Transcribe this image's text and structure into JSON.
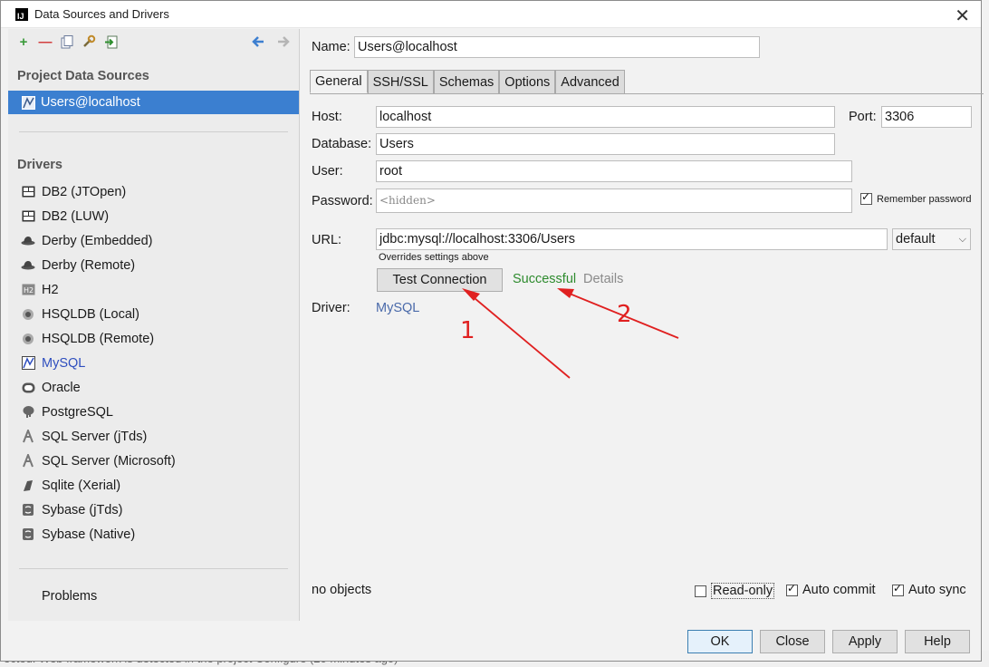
{
  "window": {
    "title": "Data Sources and Drivers",
    "close": "✕"
  },
  "background": {
    "status_text": "ected: Web framework is detected in the project Configure (20 minutes ago)"
  },
  "left": {
    "project_header": "Project Data Sources",
    "selected_source": "Users@localhost",
    "drivers_header": "Drivers",
    "drivers": [
      {
        "label": "DB2 (JTOpen)",
        "icon": "db2-icon"
      },
      {
        "label": "DB2 (LUW)",
        "icon": "db2-icon"
      },
      {
        "label": "Derby (Embedded)",
        "icon": "derby-icon"
      },
      {
        "label": "Derby (Remote)",
        "icon": "derby-icon"
      },
      {
        "label": "H2",
        "icon": "h2-icon"
      },
      {
        "label": "HSQLDB (Local)",
        "icon": "hsqldb-icon"
      },
      {
        "label": "HSQLDB (Remote)",
        "icon": "hsqldb-icon"
      },
      {
        "label": "MySQL",
        "icon": "mysql-icon"
      },
      {
        "label": "Oracle",
        "icon": "oracle-icon"
      },
      {
        "label": "PostgreSQL",
        "icon": "postgresql-icon"
      },
      {
        "label": "SQL Server (jTds)",
        "icon": "sqlserver-icon"
      },
      {
        "label": "SQL Server (Microsoft)",
        "icon": "sqlserver-icon"
      },
      {
        "label": "Sqlite (Xerial)",
        "icon": "sqlite-icon"
      },
      {
        "label": "Sybase (jTds)",
        "icon": "sybase-icon"
      },
      {
        "label": "Sybase (Native)",
        "icon": "sybase-icon"
      }
    ],
    "problems": "Problems"
  },
  "form": {
    "name_label": "Name:",
    "name_value": "Users@localhost",
    "tabs": [
      "General",
      "SSH/SSL",
      "Schemas",
      "Options",
      "Advanced"
    ],
    "host_label": "Host:",
    "host_value": "localhost",
    "port_label": "Port:",
    "port_value": "3306",
    "database_label": "Database:",
    "database_value": "Users",
    "user_label": "User:",
    "user_value": "root",
    "password_label": "Password:",
    "password_placeholder": "<hidden>",
    "remember_password": "Remember password",
    "url_label": "URL:",
    "url_value": "jdbc:mysql://localhost:3306/Users",
    "url_mode": "default",
    "url_note": "Overrides settings above",
    "test_connection": "Test Connection",
    "status": "Successful",
    "details": "Details",
    "driver_label": "Driver:",
    "driver_value": "MySQL",
    "objects": "no objects",
    "read_only": "Read-only",
    "auto_commit": "Auto commit",
    "auto_sync": "Auto sync"
  },
  "buttons": {
    "ok": "OK",
    "close": "Close",
    "apply": "Apply",
    "help": "Help"
  },
  "annotations": {
    "one": "1",
    "two": "2"
  },
  "colors": {
    "selection": "#3b7fd0",
    "success": "#2e8b2e",
    "link": "#2f4fbf",
    "annotation": "#e02020"
  }
}
